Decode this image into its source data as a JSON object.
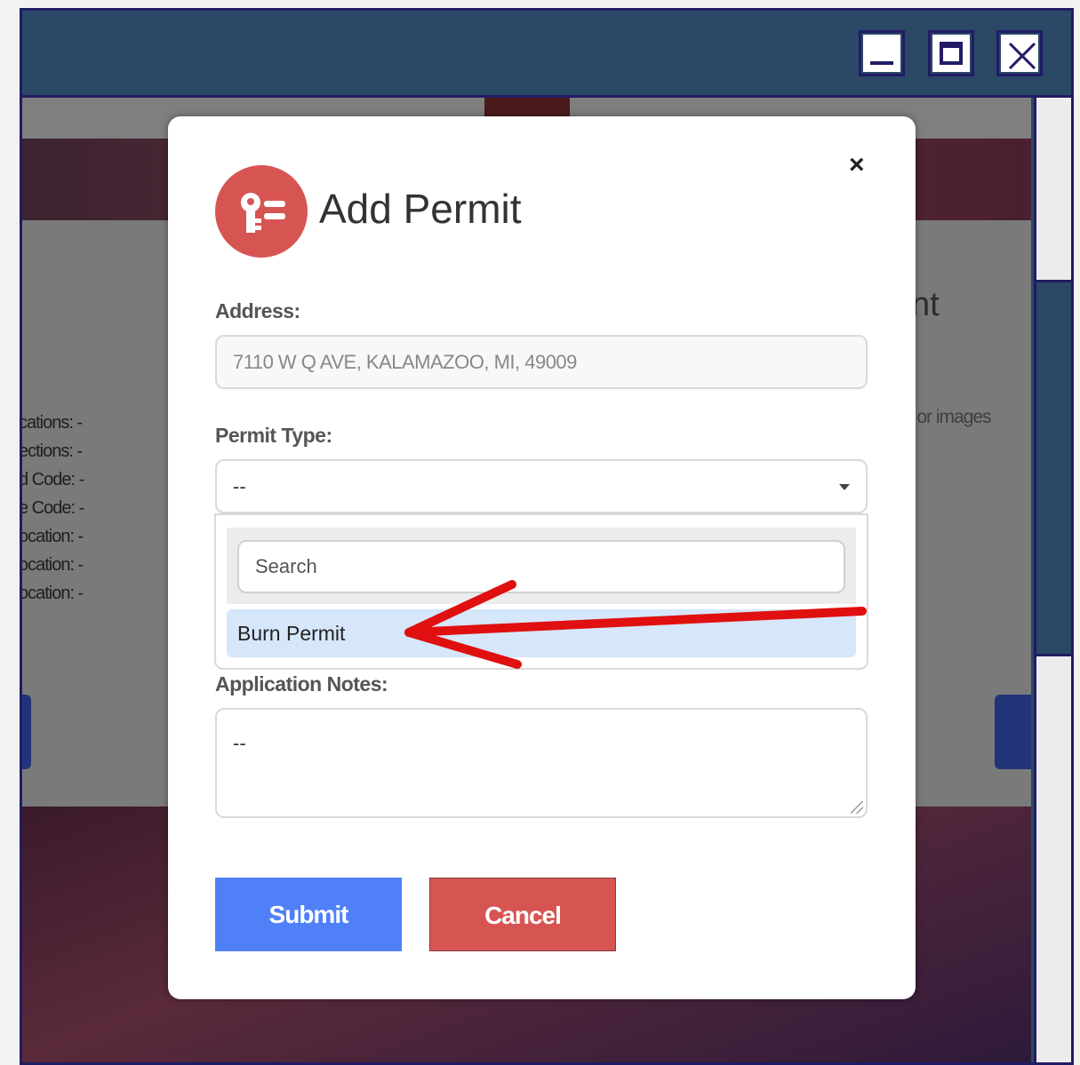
{
  "window": {
    "controls": [
      "minimize-icon",
      "maximize-icon",
      "close-icon"
    ]
  },
  "background": {
    "labels": [
      "cations:  -",
      "ections:  -",
      "d Code:  -",
      "e Code:  -",
      "ocation:  -",
      "ocation:  -",
      "ocation:  -"
    ],
    "right_heading": "nt",
    "right_text": "s or images"
  },
  "modal": {
    "title": "Add Permit",
    "close_label": "×",
    "icon": "key-list-icon",
    "address_label": "Address:",
    "address_value": "7110 W Q AVE, KALAMAZOO, MI, 49009",
    "permit_type_label": "Permit Type:",
    "permit_type_value": "--",
    "search_placeholder": "Search",
    "options": [
      "Burn Permit"
    ],
    "notes_label": "Application Notes:",
    "notes_value": "--",
    "submit_label": "Submit",
    "cancel_label": "Cancel"
  },
  "colors": {
    "titlebar": "#2b4867",
    "border": "#201c64",
    "icon_circle": "#d65553",
    "submit": "#4f80f7",
    "cancel": "#d65553",
    "option_highlight": "#d6e6fb",
    "annotation_arrow": "#e01010"
  }
}
